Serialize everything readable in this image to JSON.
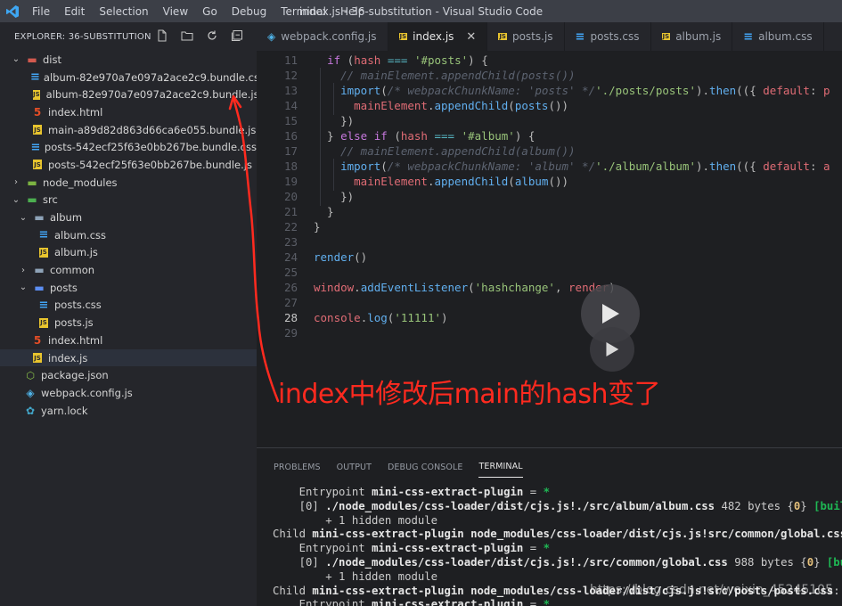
{
  "titlebar": {
    "menu": [
      "File",
      "Edit",
      "Selection",
      "View",
      "Go",
      "Debug",
      "Terminal",
      "Help"
    ],
    "title": "index.js - 36-substitution - Visual Studio Code"
  },
  "explorer": {
    "header": "EXPLORER: 36-SUBSTITUTION",
    "items": [
      {
        "label": "dist"
      },
      {
        "label": "album-82e970a7e097a2ace2c9.bundle.css"
      },
      {
        "label": "album-82e970a7e097a2ace2c9.bundle.js"
      },
      {
        "label": "index.html"
      },
      {
        "label": "main-a89d82d863d66ca6e055.bundle.js"
      },
      {
        "label": "posts-542ecf25f63e0bb267be.bundle.css"
      },
      {
        "label": "posts-542ecf25f63e0bb267be.bundle.js"
      },
      {
        "label": "node_modules"
      },
      {
        "label": "src"
      },
      {
        "label": "album"
      },
      {
        "label": "album.css"
      },
      {
        "label": "album.js"
      },
      {
        "label": "common"
      },
      {
        "label": "posts"
      },
      {
        "label": "posts.css"
      },
      {
        "label": "posts.js"
      },
      {
        "label": "index.html"
      },
      {
        "label": "index.js"
      },
      {
        "label": "package.json"
      },
      {
        "label": "webpack.config.js"
      },
      {
        "label": "yarn.lock"
      }
    ]
  },
  "tabs": [
    {
      "label": "webpack.config.js",
      "icon": "webpack-icon"
    },
    {
      "label": "index.js",
      "icon": "js-icon"
    },
    {
      "label": "posts.js",
      "icon": "js-icon"
    },
    {
      "label": "posts.css",
      "icon": "css-icon"
    },
    {
      "label": "album.js",
      "icon": "js-icon"
    },
    {
      "label": "album.css",
      "icon": "css-icon"
    }
  ],
  "editor": {
    "line_numbers": [
      "11",
      "12",
      "13",
      "14",
      "15",
      "16",
      "17",
      "18",
      "19",
      "20",
      "21",
      "22",
      "23",
      "24",
      "25",
      "26",
      "27",
      "28",
      "29"
    ],
    "current_line": "28",
    "annotation": "index中修改后main的hash变了"
  },
  "panel": {
    "tabs": [
      "PROBLEMS",
      "OUTPUT",
      "DEBUG CONSOLE",
      "TERMINAL"
    ],
    "watermark": "https://blog.csdn.net/weixin_45245105"
  },
  "colors": {
    "accent_red": "#ff2a1f",
    "keyword": "#c678dd",
    "identifier": "#e06c75",
    "function": "#61afef",
    "string": "#98c379",
    "comment": "#5c6370"
  }
}
